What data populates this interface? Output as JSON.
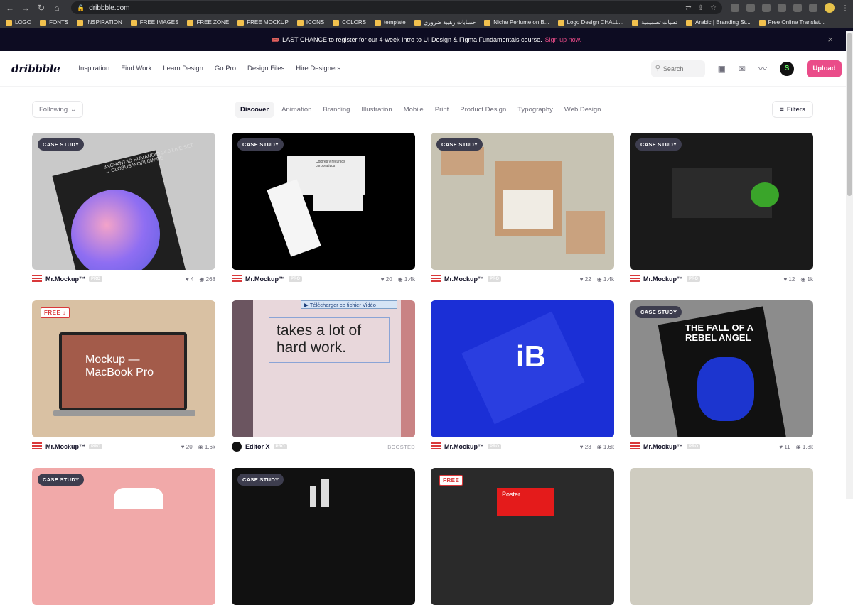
{
  "browser": {
    "url": "dribbble.com",
    "bookmarks": [
      "LOGO",
      "FONTS",
      "INSPIRATION",
      "FREE IMAGES",
      "FREE ZONE",
      "FREE MOCKUP",
      "ICONS",
      "COLORS",
      "template",
      "حسابات رهيبة ضروري",
      "Niche Perfume on B...",
      "Logo Design CHALL...",
      "تقنيات تصميمية",
      "Arabic | Branding St...",
      "Free Online Translat..."
    ]
  },
  "announcement": {
    "icon": "🎟️",
    "text": "LAST CHANCE to register for our 4-week Intro to UI Design & Figma Fundamentals course.",
    "link": "Sign up now.",
    "close": "×"
  },
  "nav": {
    "logo": "dribbble",
    "links": [
      "Inspiration",
      "Find Work",
      "Learn Design",
      "Go Pro",
      "Design Files",
      "Hire Designers"
    ],
    "search_placeholder": "Search",
    "profile_initial": "S",
    "upload": "Upload"
  },
  "filters": {
    "following": "Following",
    "categories": [
      "Discover",
      "Animation",
      "Branding",
      "Illustration",
      "Mobile",
      "Print",
      "Product Design",
      "Typography",
      "Web Design"
    ],
    "filters_label": "Filters"
  },
  "shots": [
    {
      "badge": "CASE STUDY",
      "author": "Mr.Mockup™",
      "pro": "PRO",
      "likes": "4",
      "views": "268",
      "bg": "#c9c9c9",
      "art": "3NCH4NT3D HUMANOID 24.0 LIVE SET → GLOBUS WORLDWIDE"
    },
    {
      "badge": "CASE STUDY",
      "author": "Mr.Mockup™",
      "pro": "PRO",
      "likes": "20",
      "views": "1.4k",
      "bg": "#000000",
      "art": "Colores y recursos corporativos"
    },
    {
      "badge": "CASE STUDY",
      "author": "Mr.Mockup™",
      "pro": "PRO",
      "likes": "22",
      "views": "1.4k",
      "bg": "#c7c3b3",
      "art": ""
    },
    {
      "badge": "CASE STUDY",
      "author": "Mr.Mockup™",
      "pro": "PRO",
      "likes": "12",
      "views": "1k",
      "bg": "#1a1a1a",
      "art": ""
    },
    {
      "badge": "FREE ↓",
      "author": "Mr.Mockup™",
      "pro": "PRO",
      "likes": "20",
      "views": "1.6k",
      "bg": "#d9c1a3",
      "art": "Mockup — MacBook Pro"
    },
    {
      "badge": "",
      "author": "Editor X",
      "pro": "PRO",
      "boosted": "BOOSTED",
      "bg": "#e8d7db",
      "art": "takes a lot of hard work.",
      "video": "▶ Télécharger ce fichier Vidéo"
    },
    {
      "badge": "",
      "author": "Mr.Mockup™",
      "pro": "PRO",
      "likes": "23",
      "views": "1.6k",
      "bg": "#1b2fd6",
      "art": "iB"
    },
    {
      "badge": "CASE STUDY",
      "author": "Mr.Mockup™",
      "pro": "PRO",
      "likes": "11",
      "views": "1.8k",
      "bg": "#8c8c8c",
      "art": "THE FALL OF A REBEL ANGEL"
    },
    {
      "badge": "CASE STUDY",
      "bg": "#f1a9a9"
    },
    {
      "badge": "CASE STUDY",
      "bg": "#111111"
    },
    {
      "badge": "FREE",
      "bg": "#2a2a2a",
      "art": "Poster"
    },
    {
      "badge": "",
      "bg": "#cfccc0"
    }
  ]
}
